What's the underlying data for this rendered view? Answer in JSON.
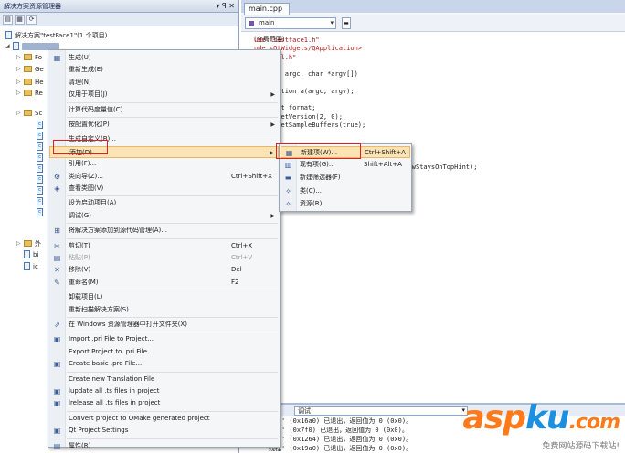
{
  "solution_explorer": {
    "title": "解决方案资源管理器",
    "pin": "▾ ꟼ ✕",
    "solution_label": "解决方案\"testFace1\"(1 个项目)",
    "tree": [
      "Fo",
      "Ge",
      "He",
      "Re",
      "Sc",
      "外",
      "bi",
      "ic"
    ]
  },
  "editor": {
    "tab": "main.cpp",
    "nav_select": "main",
    "scope": "(全局范围)",
    "code_lines": [
      {
        "cls": "c-str",
        "text": "ude \"testface1.h\""
      },
      {
        "cls": "c-red",
        "text": "ude <QtWidgets/QApplication>"
      },
      {
        "cls": "c-str",
        "text": "ude \"qgl.h\""
      },
      {
        "cls": "c-dark",
        "text": ""
      },
      {
        "cls": "c-dark",
        "text": "ain(int argc, char *argv[])"
      },
      {
        "cls": "c-dark",
        "text": ""
      },
      {
        "cls": "c-dark",
        "text": "Application a(argc, argv);"
      },
      {
        "cls": "c-dark",
        "text": ""
      },
      {
        "cls": "c-dark",
        "text": "GLFormat format;"
      },
      {
        "cls": "c-dark",
        "text": "ormat.setVersion(2, 0);"
      },
      {
        "cls": "c-dark",
        "text": "ormat.setSampleBuffers(true);"
      },
      {
        "cls": "c-dark",
        "text": ""
      },
      {
        "cls": "c-dark",
        "text": ""
      },
      {
        "cls": "c-dark",
        "text": ""
      },
      {
        "cls": "c-dark",
        "text": ""
      },
      {
        "cls": "c-dark",
        "text": "                              | Qt::WindowStaysOnTopHint);"
      },
      {
        "cls": "c-dark",
        "text": "                              onModal);"
      }
    ]
  },
  "output": {
    "select": "调试",
    "lines": [
      "线程' (0x16a0) 已退出，返回值为 0 (0x0)。",
      "线程' (0x7f0) 已退出，返回值为 0 (0x0)。",
      "线程' (0x1264) 已退出，返回值为 0 (0x0)。",
      "线程' (0x19a0) 已退出，返回值为 0 (0x0)。"
    ]
  },
  "context_menu": {
    "items": [
      {
        "label": "生成(U)",
        "icon": "build-icon",
        "glyph": "▦"
      },
      {
        "label": "重新生成(E)"
      },
      {
        "label": "清理(N)"
      },
      {
        "label": "仅用于项目(J)",
        "arrow": true
      },
      {
        "sep": true
      },
      {
        "label": "计算代码度量值(C)"
      },
      {
        "sep": true
      },
      {
        "label": "按配置优化(P)",
        "arrow": true
      },
      {
        "sep": true
      },
      {
        "label": "生成自定义(B)..."
      },
      {
        "label": "添加(D)",
        "arrow": true,
        "highlight": true
      },
      {
        "label": "引用(F)..."
      },
      {
        "label": "类向导(Z)...",
        "shortcut": "Ctrl+Shift+X",
        "icon": "class-wizard-icon",
        "glyph": "⚙"
      },
      {
        "label": "查看类图(V)",
        "icon": "class-diagram-icon",
        "glyph": "◈"
      },
      {
        "sep": true
      },
      {
        "label": "设为启动项目(A)"
      },
      {
        "label": "调试(G)",
        "arrow": true
      },
      {
        "sep": true
      },
      {
        "label": "将解决方案添加到源代码管理(A)...",
        "icon": "source-control-icon",
        "glyph": "⊞"
      },
      {
        "sep": true
      },
      {
        "label": "剪切(T)",
        "shortcut": "Ctrl+X",
        "icon": "cut-icon",
        "glyph": "✂"
      },
      {
        "label": "粘贴(P)",
        "shortcut": "Ctrl+V",
        "icon": "paste-icon",
        "glyph": "▤",
        "disabled": true
      },
      {
        "label": "移除(V)",
        "shortcut": "Del",
        "icon": "remove-icon",
        "glyph": "✕"
      },
      {
        "label": "重命名(M)",
        "shortcut": "F2",
        "icon": "rename-icon",
        "glyph": "✎"
      },
      {
        "sep": true
      },
      {
        "label": "卸载项目(L)"
      },
      {
        "label": "重新扫描解决方案(S)"
      },
      {
        "sep": true
      },
      {
        "label": "在 Windows 资源管理器中打开文件夹(X)",
        "icon": "open-folder-icon",
        "glyph": "⇗"
      },
      {
        "sep": true
      },
      {
        "label": "Import .pri File to Project...",
        "icon": "import-pri-icon",
        "glyph": "▣"
      },
      {
        "label": "Export Project to .pri File..."
      },
      {
        "label": "Create basic .pro File...",
        "icon": "create-pro-icon",
        "glyph": "▣"
      },
      {
        "sep": true
      },
      {
        "label": "Create new Translation File"
      },
      {
        "label": "lupdate all .ts files in project",
        "icon": "lupdate-icon",
        "glyph": "▣"
      },
      {
        "label": "lrelease all .ts files in project",
        "icon": "lrelease-icon",
        "glyph": "▣"
      },
      {
        "sep": true
      },
      {
        "label": "Convert project to QMake generated project"
      },
      {
        "label": "Qt Project Settings",
        "icon": "qt-settings-icon",
        "glyph": "▣"
      },
      {
        "sep": true
      },
      {
        "label": "属性(R)",
        "icon": "properties-icon",
        "glyph": "▤"
      }
    ]
  },
  "submenu": {
    "items": [
      {
        "label": "新建项(W)...",
        "shortcut": "Ctrl+Shift+A",
        "icon": "new-item-icon",
        "glyph": "▦",
        "highlight": true
      },
      {
        "label": "现有项(G)...",
        "shortcut": "Shift+Alt+A",
        "icon": "existing-item-icon",
        "glyph": "▥"
      },
      {
        "label": "新建筛选器(F)",
        "icon": "new-filter-icon",
        "glyph": "▬"
      },
      {
        "label": "类(C)...",
        "icon": "class-icon",
        "glyph": "✧"
      },
      {
        "label": "资源(R)...",
        "icon": "resource-icon",
        "glyph": "✧"
      }
    ]
  },
  "watermark": {
    "brand_a": "asp",
    "brand_b": "ku",
    "brand_c": ".com",
    "sub": "免费网站源码下载站!"
  }
}
